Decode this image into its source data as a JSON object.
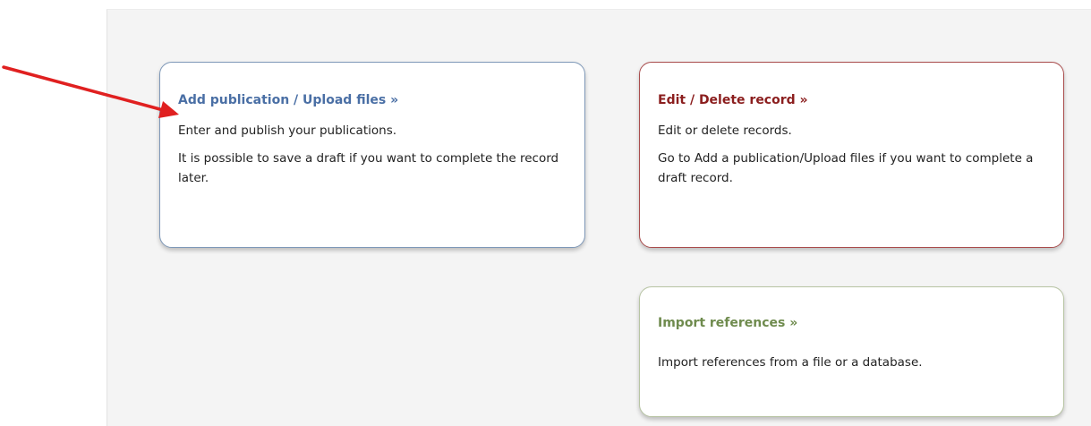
{
  "cards": {
    "add": {
      "title": "Add publication / Upload files »",
      "text1": "Enter and publish your publications.",
      "text2": "It is possible to save a draft if you want to complete the record later.",
      "border_color": "#7e98b8",
      "title_color": "#4a6fa5"
    },
    "edit": {
      "title": "Edit / Delete record »",
      "text1": "Edit or delete records.",
      "text2": "Go to Add a publication/Upload files if you want to complete a draft record.",
      "border_color": "#a94c4c",
      "title_color": "#8b1e1e"
    },
    "import": {
      "title": "Import references »",
      "text1": "Import references from a file or a database.",
      "border_color": "#b7c4a3",
      "title_color": "#6f8b4e"
    }
  },
  "annotation": {
    "arrow_color": "#e02020",
    "arrow_icon": "red-arrow-icon"
  }
}
